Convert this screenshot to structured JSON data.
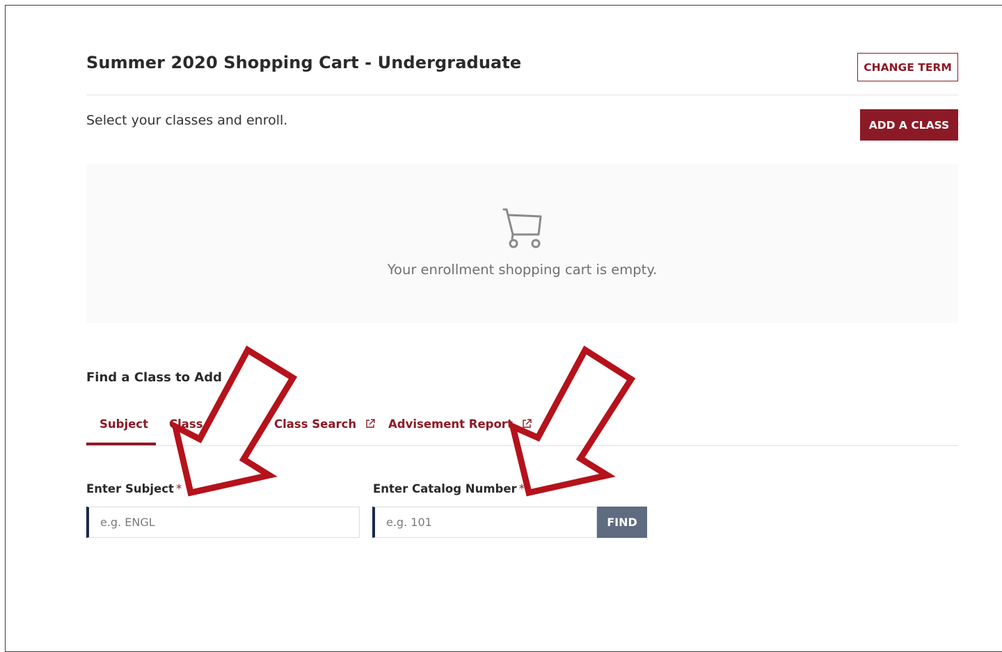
{
  "header": {
    "title": "Summer 2020 Shopping Cart - Undergraduate",
    "change_term_label": "CHANGE TERM",
    "subtitle": "Select your classes and enroll.",
    "add_class_label": "ADD A CLASS"
  },
  "cart": {
    "icon": "shopping-cart-icon",
    "empty_message": "Your enrollment shopping cart is empty."
  },
  "find_class": {
    "title": "Find a Class to Add",
    "tabs": [
      {
        "label": "Subject",
        "active": true
      },
      {
        "label": "Class",
        "active": false
      },
      {
        "label": "Class Search",
        "active": false,
        "icon": "external-link-icon"
      },
      {
        "label": "Advisement Report",
        "active": false,
        "icon": "external-link-icon"
      }
    ],
    "subject_label": "Enter Subject",
    "subject_placeholder": "e.g. ENGL",
    "catalog_label": "Enter Catalog Number",
    "catalog_placeholder": "e.g. 101",
    "required_mark": "*",
    "find_label": "FIND"
  },
  "colors": {
    "brand": "#8c1a26",
    "input_accent": "#1b2a4a",
    "find_button": "#5e6b80",
    "annotation_arrow": "#b5121b"
  }
}
